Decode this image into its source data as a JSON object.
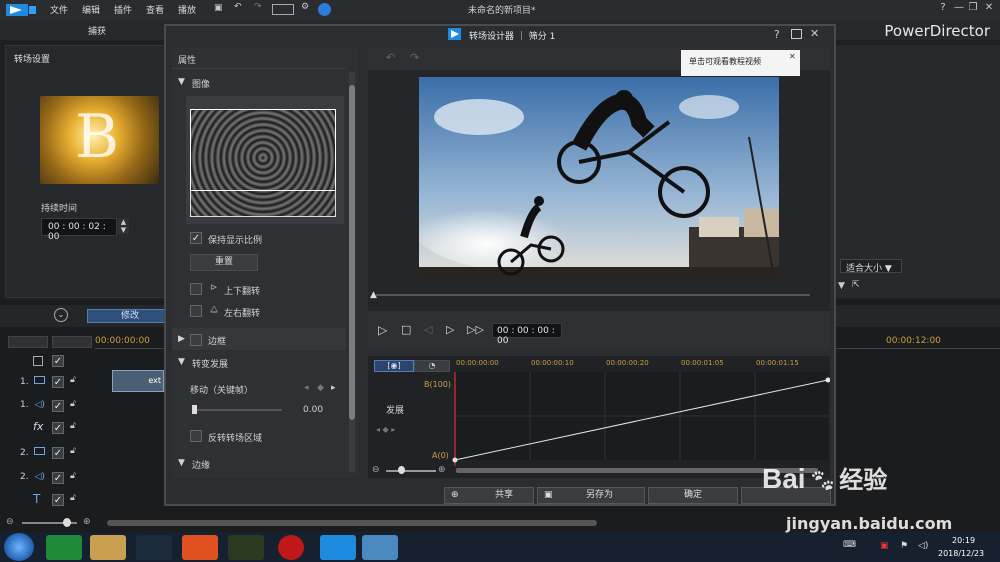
{
  "menubar": {
    "items": [
      "文件",
      "编辑",
      "插件",
      "查看",
      "播放"
    ],
    "window_title": "未命名的新项目*",
    "app_name": "PowerDirector",
    "controls": [
      "?",
      "—",
      "❐",
      "✕"
    ]
  },
  "tabs": {
    "capture": "捕获"
  },
  "left_panel": {
    "title": "转场设置",
    "duration_label": "持续时间",
    "duration_value": "00 : 00 : 02 : 00"
  },
  "timeline": {
    "modify_label": "修改",
    "ruler_left": "00:00:00:00",
    "ruler_right": "00:00:12:00",
    "tracks": [
      {
        "id": "1.",
        "type": "video"
      },
      {
        "id": "1.",
        "type": "audio"
      },
      {
        "id": "fx",
        "type": "fx"
      },
      {
        "id": "2.",
        "type": "video"
      },
      {
        "id": "2.",
        "type": "audio"
      },
      {
        "id": "T",
        "type": "text"
      }
    ],
    "clip_label": "ext"
  },
  "dialog": {
    "title": "转场设计器 ｜ 筛分 1",
    "props_title": "属性",
    "image_section": "图像",
    "keep_ratio": "保持显示比例",
    "reset": "重置",
    "flip_v": "上下翻转",
    "flip_h": "左右翻转",
    "border_section": "边框",
    "transition_section": "转变发展",
    "move_label": "移动（关键帧）",
    "move_value": "0.00",
    "reverse_label": "反转转场区域",
    "edge_section": "边缘",
    "timecode": "00 : 00 : 00 : 00",
    "tooltip": "单击可观看教程视频",
    "kf_label": "发展",
    "kf_b": "B(100)",
    "kf_a": "A(0)",
    "kf_ticks": [
      "00:00:00:00",
      "00:00:00:10",
      "00:00:00:20",
      "00:00:01:05",
      "00:00:01:15"
    ],
    "fit_label": "适合大小",
    "buttons": {
      "share": "共享",
      "saveas": "另存为",
      "ok": "确定"
    }
  },
  "taskbar": {
    "time": "20:19",
    "date": "2018/12/23"
  },
  "watermark": {
    "site": "jingyan.baidu.com",
    "logo": "Bai",
    "logo2": "经验"
  }
}
